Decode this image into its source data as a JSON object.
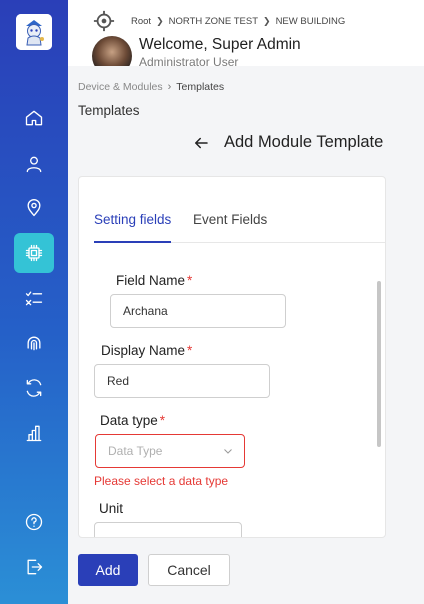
{
  "sidebar": {
    "logo_icon": "robot-mascot-logo",
    "items": [
      {
        "icon": "home-icon",
        "active": false
      },
      {
        "icon": "user-icon",
        "active": false
      },
      {
        "icon": "location-pin-icon",
        "active": false
      },
      {
        "icon": "chip-icon",
        "active": true
      },
      {
        "icon": "checklist-icon",
        "active": false
      },
      {
        "icon": "fingerprint-icon",
        "active": false
      },
      {
        "icon": "refresh-icon",
        "active": false
      },
      {
        "icon": "bar-chart-icon",
        "active": false
      },
      {
        "icon": "help-icon",
        "active": false
      },
      {
        "icon": "logout-icon",
        "active": false
      }
    ],
    "active_color": "#34c3d6"
  },
  "topbar": {
    "crumbs": [
      "Root",
      "NORTH ZONE TEST",
      "NEW BUILDING"
    ],
    "welcome": "Welcome, Super Admin",
    "role": "Administrator User"
  },
  "breadcrumb": {
    "parent": "Device & Modules",
    "current": "Templates"
  },
  "content_title": "Templates",
  "page_heading": "Add Module Template",
  "tabs": [
    {
      "label": "Setting fields",
      "active": true
    },
    {
      "label": "Event Fields",
      "active": false
    }
  ],
  "form": {
    "field_name": {
      "label": "Field Name",
      "required_mark": "*",
      "value": "Archana"
    },
    "display_name": {
      "label": "Display Name",
      "required_mark": "*",
      "value": "Red"
    },
    "data_type": {
      "label": "Data type",
      "required_mark": "*",
      "placeholder": "Data Type",
      "error": "Please select a data type"
    },
    "unit": {
      "label": "Unit"
    }
  },
  "actions": {
    "add_label": "Add",
    "cancel_label": "Cancel"
  },
  "colors": {
    "primary": "#2a3fb8",
    "error": "#e53935"
  }
}
